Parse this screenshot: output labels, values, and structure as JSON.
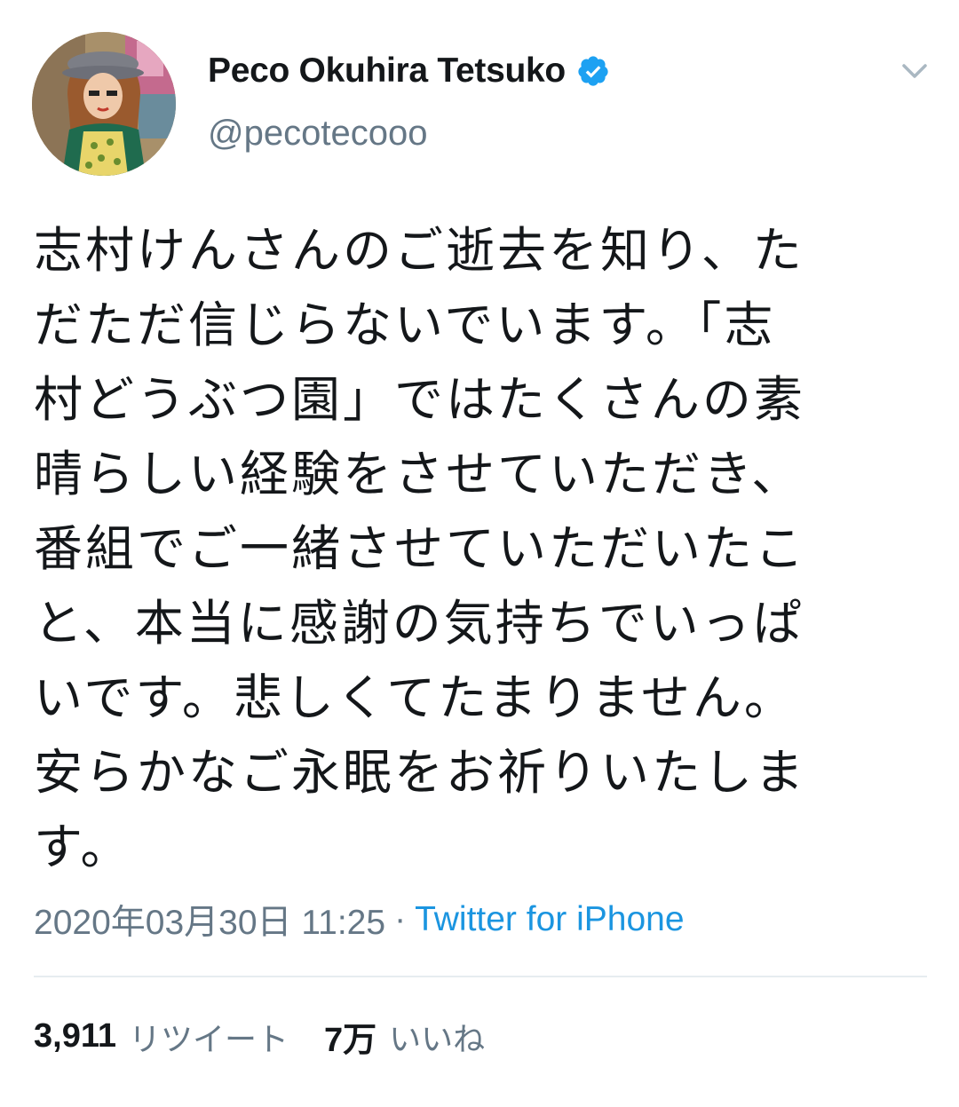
{
  "user": {
    "display_name": "Peco Okuhira Tetsuko",
    "handle": "@pecotecooo",
    "verified_icon": "verified-badge-icon",
    "accent": "#1da1f2"
  },
  "tweet": {
    "lines": [
      "志村けんさんのご逝去を知り、た",
      "だただ信じらないでいます。「志",
      "村どうぶつ園」ではたくさんの素",
      "晴らしい経験をさせていただき、",
      "番組でご一緒させていただいたこ",
      "と、本当に感謝の気持ちでいっぱ",
      "いです。悲しくてたまりません。",
      "安らかなご永眠をお祈りいたしま",
      "す。"
    ]
  },
  "meta": {
    "timestamp": "2020年03月30日 11:25",
    "separator": "·",
    "source": "Twitter for iPhone",
    "source_color": "#1b95e0"
  },
  "stats": {
    "retweets_count": "3,911",
    "retweets_label": "リツイート",
    "likes_count": "7万",
    "likes_label": "いいね"
  }
}
